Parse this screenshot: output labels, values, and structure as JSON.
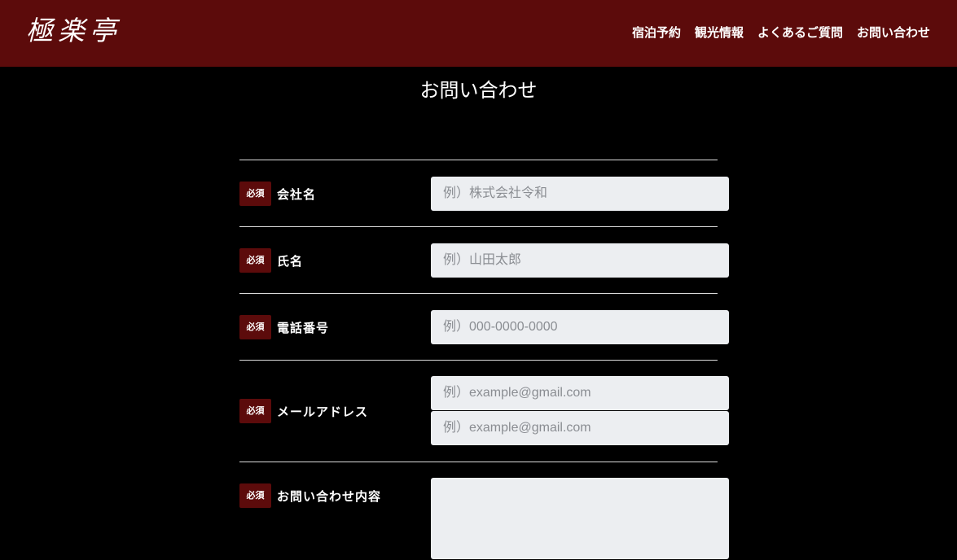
{
  "header": {
    "logo": "極楽亭",
    "nav": [
      "宿泊予約",
      "観光情報",
      "よくあるご質問",
      "お問い合わせ"
    ]
  },
  "page_title": "お問い合わせ",
  "form": {
    "required_badge": "必須",
    "company": {
      "label": "会社名",
      "placeholder": "例）株式会社令和"
    },
    "name": {
      "label": "氏名",
      "placeholder": "例）山田太郎"
    },
    "phone": {
      "label": "電話番号",
      "placeholder": "例）000-0000-0000"
    },
    "email": {
      "label": "メールアドレス",
      "placeholder": "例）example@gmail.com",
      "confirm_placeholder": "例）example@gmail.com"
    },
    "inquiry": {
      "label": "お問い合わせ内容",
      "placeholder": ""
    }
  },
  "colors": {
    "header_bg": "#5c0b0b",
    "badge_bg": "#5c0b0b",
    "page_bg": "#000000",
    "field_bg": "#eceef1"
  }
}
